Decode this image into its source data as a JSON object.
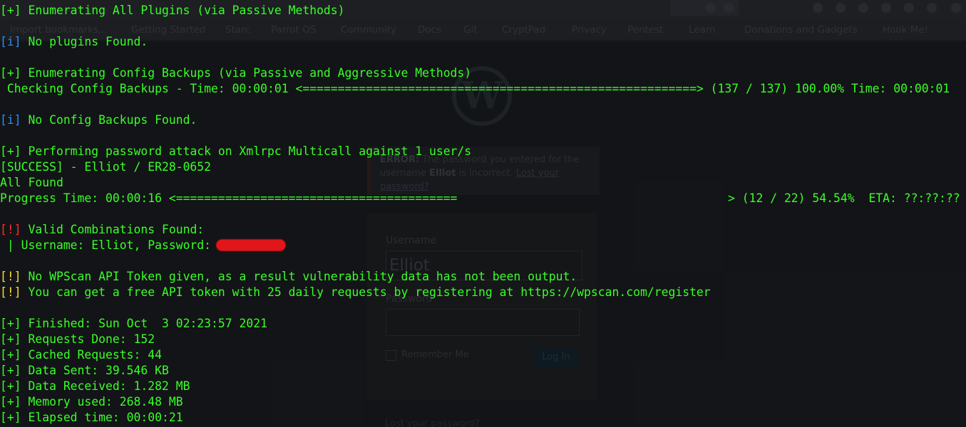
{
  "browser": {
    "bookmarks": [
      "Import bookmarks...",
      "Getting Started",
      "Starc",
      "Parrot OS",
      "Community",
      "Docs",
      "Git",
      "CryptPad",
      "Privacy",
      "Pentest",
      "Learn",
      "Donations and Gadgets",
      "Hook Me!"
    ]
  },
  "wp_login": {
    "error_label": "ERROR:",
    "error_text_1": " The password you entered for the",
    "error_text_2": "username ",
    "error_user": "Elliot",
    "error_text_3": " is incorrect. ",
    "lost_password_link": "Lost your password?",
    "username_label": "Username",
    "username_value": "Elliot",
    "password_label": "Password",
    "remember_label": "Remember Me",
    "login_button": "Log In",
    "lost_link_bottom": "Lost your password?"
  },
  "terminal": {
    "lines": [
      {
        "tag": "[+]",
        "text": " Enumerating All Plugins (via Passive Methods)"
      },
      {
        "tag": "",
        "text": ""
      },
      {
        "tag": "[i]",
        "text": " No plugins Found."
      },
      {
        "tag": "",
        "text": ""
      },
      {
        "tag": "[+]",
        "text": " Enumerating Config Backups (via Passive and Aggressive Methods)"
      },
      {
        "tag": "",
        "text": " Checking Config Backups - Time: 00:00:01 <========================================================> (137 / 137) 100.00% Time: 00:00:01"
      },
      {
        "tag": "",
        "text": ""
      },
      {
        "tag": "[i]",
        "text": " No Config Backups Found."
      },
      {
        "tag": "",
        "text": ""
      },
      {
        "tag": "[+]",
        "text": " Performing password attack on Xmlrpc Multicall against 1 user/s"
      },
      {
        "tag": "",
        "text": "[SUCCESS] - Elliot / ER28-0652"
      },
      {
        "tag": "",
        "text": "All Found"
      },
      {
        "tag": "",
        "text": "Progress Time: 00:00:16 <========================================"
      },
      {
        "tag": "",
        "text": ""
      },
      {
        "tag": "[!]",
        "text": " Valid Combinations Found:"
      },
      {
        "tag": "",
        "text": " | Username: Elliot, Password:"
      },
      {
        "tag": "",
        "text": ""
      },
      {
        "tag": "[!]",
        "text": " No WPScan API Token given, as a result vulnerability data has not been output."
      },
      {
        "tag": "[!]",
        "text": " You can get a free API token with 25 daily requests by registering at https://wpscan.com/register"
      },
      {
        "tag": "",
        "text": ""
      },
      {
        "tag": "[+]",
        "text": " Finished: Sun Oct  3 02:23:57 2021"
      },
      {
        "tag": "[+]",
        "text": " Requests Done: 152"
      },
      {
        "tag": "[+]",
        "text": " Cached Requests: 44"
      },
      {
        "tag": "[+]",
        "text": " Data Sent: 39.546 KB"
      },
      {
        "tag": "[+]",
        "text": " Data Received: 1.282 MB"
      },
      {
        "tag": "[+]",
        "text": " Memory used: 268.48 MB"
      },
      {
        "tag": "[+]",
        "text": " Elapsed time: 00:00:21"
      }
    ],
    "progress_right": "> (12 / 22) 54.54%  ETA: ??:??:??",
    "progress_fraction": 0.5454
  },
  "colors": {
    "terminal_green": "#39ff28",
    "info_blue": "#2d8ef5",
    "alert_red": "#ff2d2d",
    "warn_yellow": "#ffdd33",
    "redaction_red": "#e0161a"
  }
}
